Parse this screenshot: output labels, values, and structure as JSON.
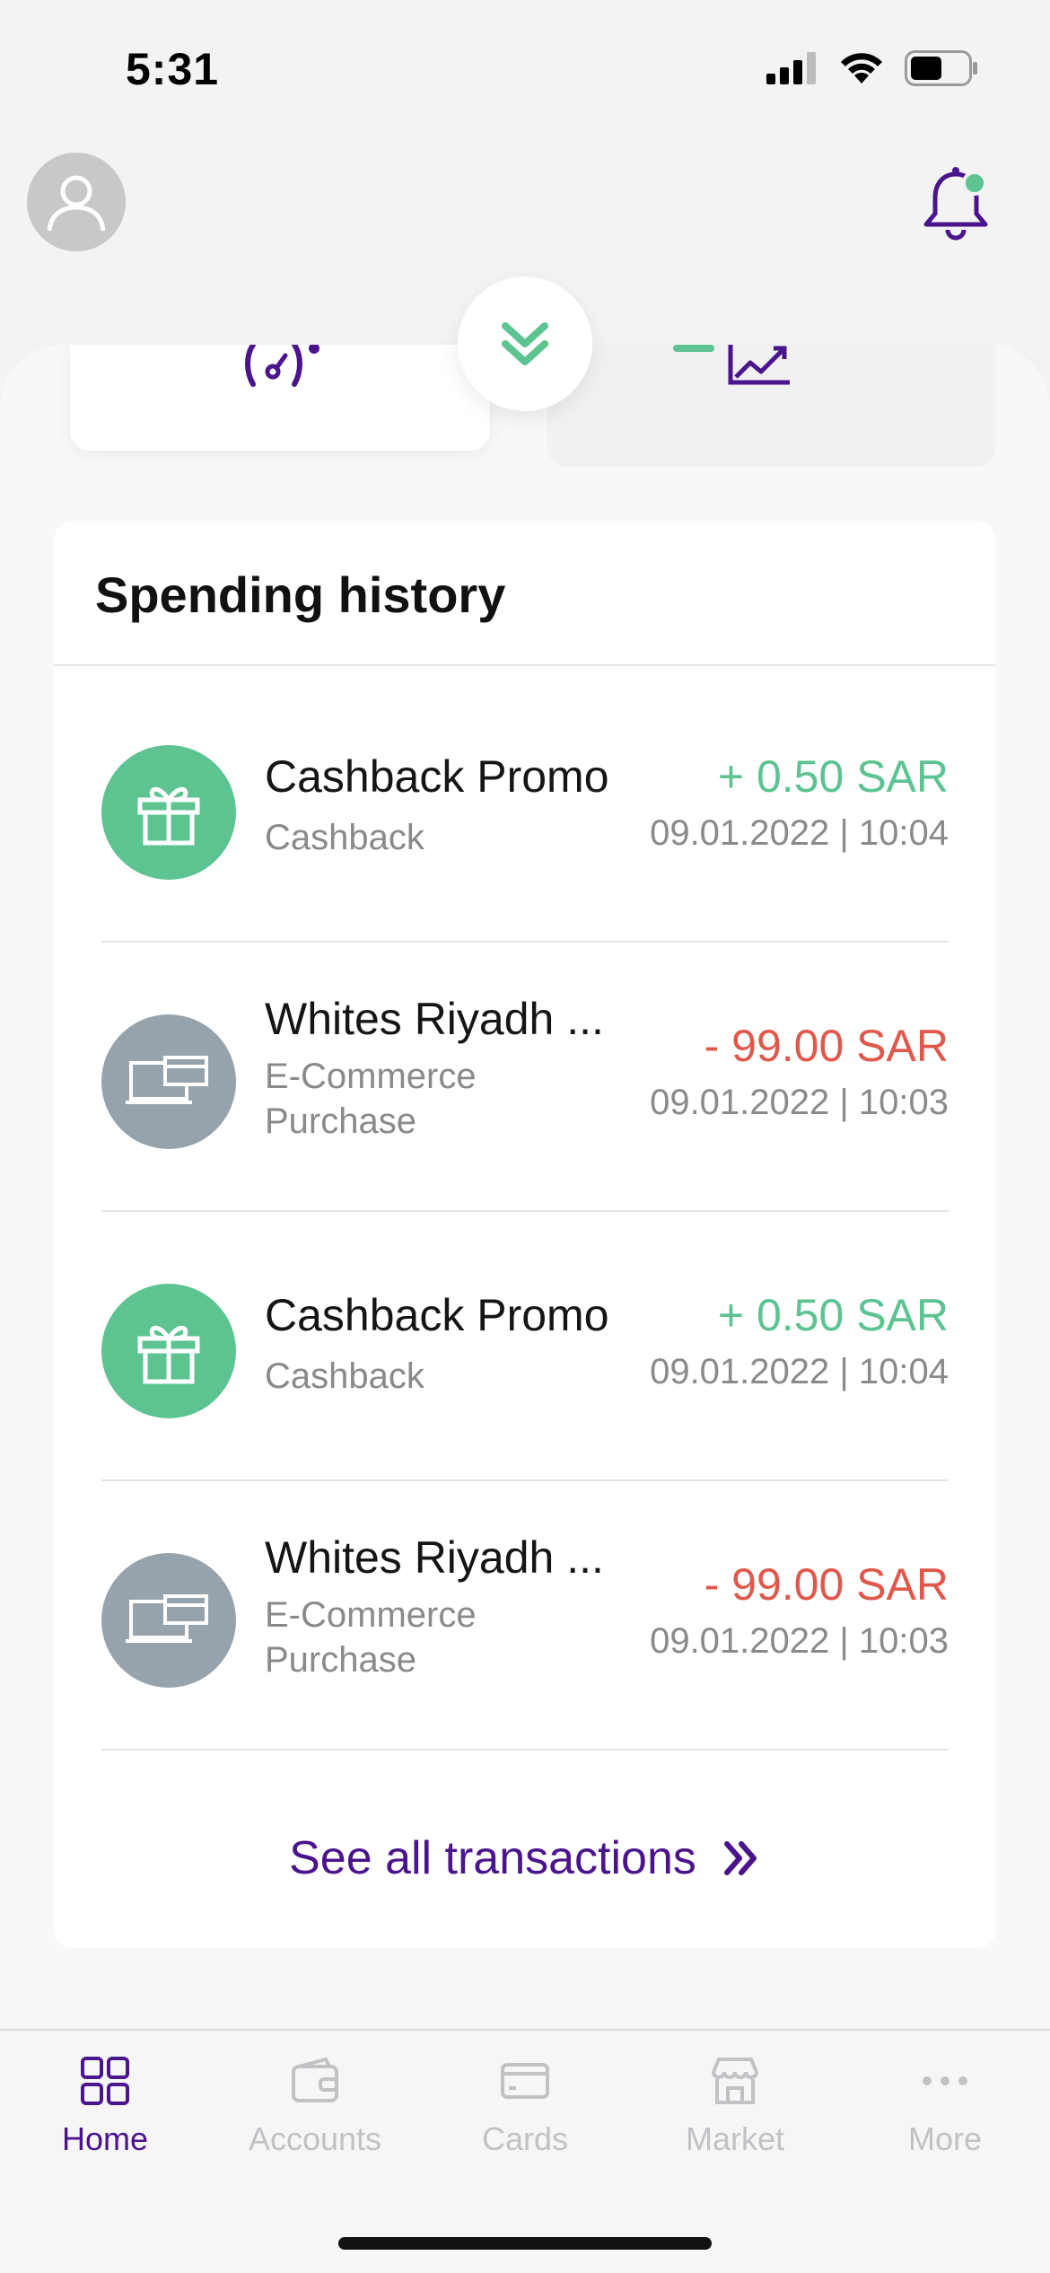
{
  "status_bar": {
    "time": "5:31"
  },
  "spending_history": {
    "title": "Spending history",
    "transactions": [
      {
        "name": "Cashback Promo",
        "category": "Cashback",
        "amount": "+ 0.50 SAR",
        "datetime": "09.01.2022 | 10:04",
        "type": "credit",
        "icon": "gift-icon"
      },
      {
        "name": "Whites Riyadh ...",
        "category": "E-Commerce Purchase",
        "amount": "- 99.00 SAR",
        "datetime": "09.01.2022 | 10:03",
        "type": "debit",
        "icon": "card-payment-icon"
      },
      {
        "name": "Cashback Promo",
        "category": "Cashback",
        "amount": "+ 0.50 SAR",
        "datetime": "09.01.2022 | 10:04",
        "type": "credit",
        "icon": "gift-icon"
      },
      {
        "name": "Whites Riyadh ...",
        "category": "E-Commerce Purchase",
        "amount": "- 99.00 SAR",
        "datetime": "09.01.2022 | 10:03",
        "type": "debit",
        "icon": "card-payment-icon"
      }
    ],
    "see_all_label": "See all transactions"
  },
  "tab_bar": {
    "tabs": [
      {
        "label": "Home",
        "icon": "grid-icon",
        "active": true
      },
      {
        "label": "Accounts",
        "icon": "wallet-icon",
        "active": false
      },
      {
        "label": "Cards",
        "icon": "card-icon",
        "active": false
      },
      {
        "label": "Market",
        "icon": "store-icon",
        "active": false
      },
      {
        "label": "More",
        "icon": "more-dots-icon",
        "active": false
      }
    ]
  },
  "colors": {
    "brand_purple": "#4a148c",
    "positive_green": "#5cc391",
    "negative_red": "#e0584b",
    "icon_grey": "#96a3ad"
  }
}
